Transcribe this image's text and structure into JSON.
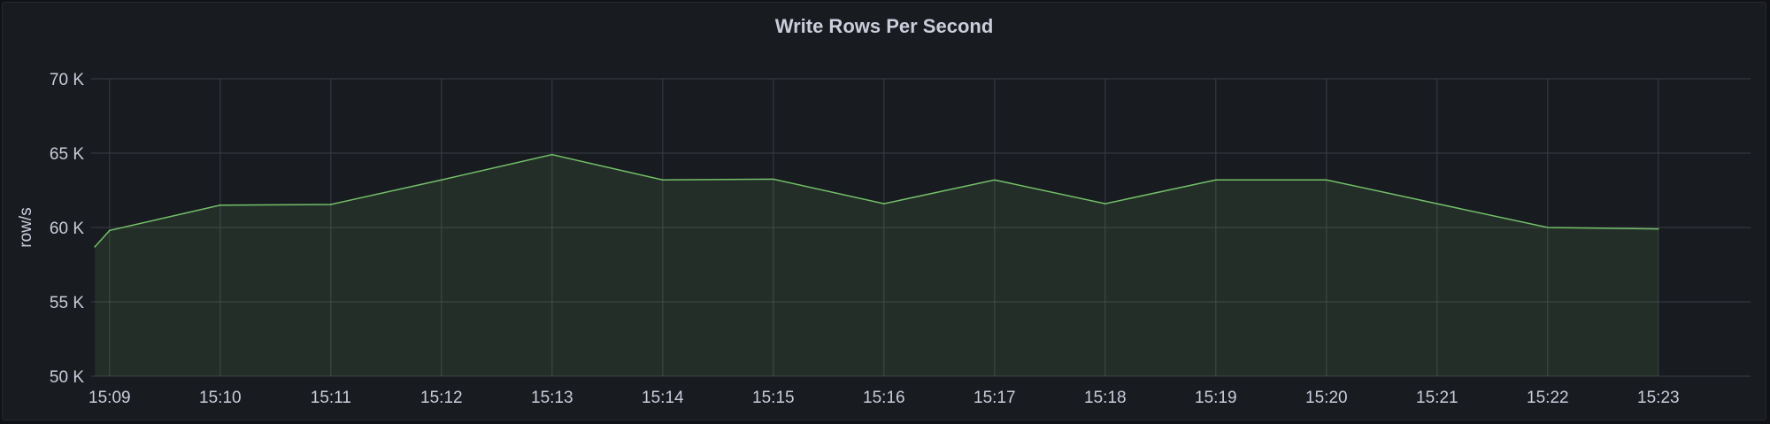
{
  "panel": {
    "title": "Write Rows Per Second"
  },
  "chart_data": {
    "type": "area",
    "title": "Write Rows Per Second",
    "xlabel": "",
    "ylabel": "row/s",
    "x_ticks": [
      "15:09",
      "15:10",
      "15:11",
      "15:12",
      "15:13",
      "15:14",
      "15:15",
      "15:16",
      "15:17",
      "15:18",
      "15:19",
      "15:20",
      "15:21",
      "15:22",
      "15:23"
    ],
    "y_ticks": [
      "50 K",
      "55 K",
      "60 K",
      "65 K",
      "70 K"
    ],
    "ylim": [
      50000,
      70000
    ],
    "xlim": [
      "15:08:50",
      "15:23:50"
    ],
    "grid": true,
    "legend": "none",
    "colors": {
      "line": "#73bf69",
      "fill": "rgba(115,191,105,0.12)",
      "grid": "#3a3d44",
      "text": "#ccccdc"
    },
    "series": [
      {
        "x": [
          "15:08:52",
          "15:09",
          "15:10",
          "15:11",
          "15:12",
          "15:13",
          "15:14",
          "15:15",
          "15:16",
          "15:17",
          "15:18",
          "15:19",
          "15:20",
          "15:21",
          "15:22",
          "15:23"
        ],
        "values": [
          58700,
          59800,
          61500,
          61550,
          63200,
          64900,
          63200,
          63250,
          61600,
          63200,
          61600,
          63200,
          63200,
          61600,
          60000,
          59900
        ]
      }
    ]
  }
}
